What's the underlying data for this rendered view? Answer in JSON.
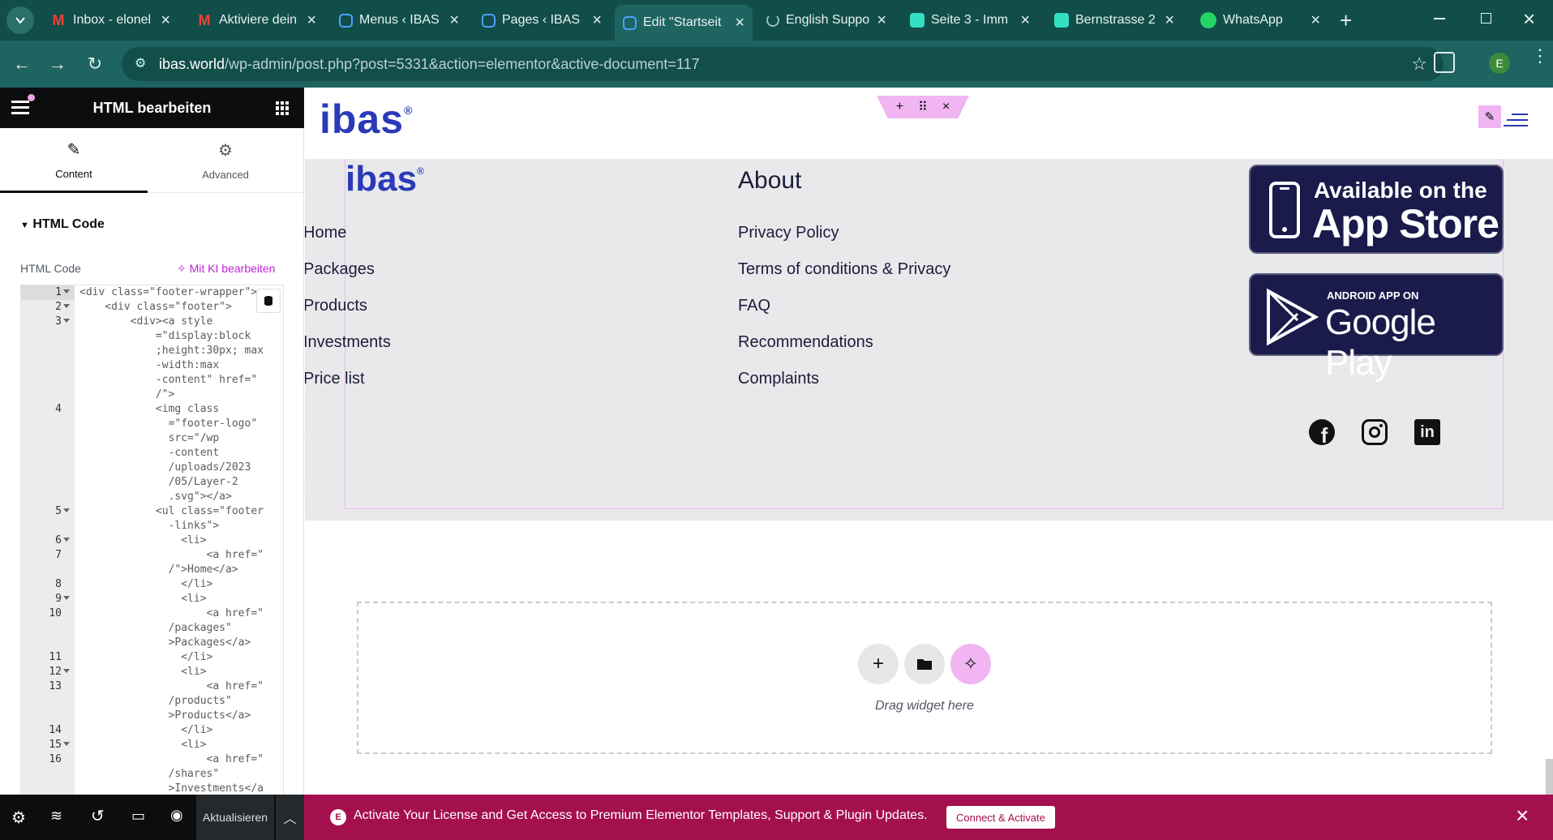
{
  "browser": {
    "tabs": [
      {
        "title": "Inbox - elonel",
        "icon": "gmail-icon",
        "active": false
      },
      {
        "title": "Aktiviere dein",
        "icon": "gmail-icon",
        "active": false
      },
      {
        "title": "Menus ‹ IBAS",
        "icon": "elementor-icon",
        "active": false
      },
      {
        "title": "Pages ‹ IBAS",
        "icon": "elementor-icon",
        "active": false
      },
      {
        "title": "Edit \"Startseit",
        "icon": "elementor-icon",
        "active": true
      },
      {
        "title": "English Suppo",
        "icon": "loading-icon",
        "active": false
      },
      {
        "title": "Seite 3 - Imm",
        "icon": "site-icon",
        "active": false
      },
      {
        "title": "Bernstrasse 2",
        "icon": "site-icon",
        "active": false
      },
      {
        "title": "WhatsApp",
        "icon": "whatsapp-icon",
        "active": false
      }
    ],
    "url_host": "ibas.world",
    "url_path": "/wp-admin/post.php?post=5331&action=elementor&active-document=117",
    "profile_letter": "E"
  },
  "sidebar": {
    "title": "HTML bearbeiten",
    "tabs": [
      {
        "label": "Content"
      },
      {
        "label": "Advanced"
      }
    ],
    "section_title": "HTML Code",
    "field_label": "HTML Code",
    "ai_button": "Mit KI bearbeiten",
    "code_lines": [
      {
        "n": "1",
        "fold": true,
        "text": "<div class=\"footer-wrapper\">"
      },
      {
        "n": "2",
        "fold": true,
        "text": "    <div class=\"footer\">"
      },
      {
        "n": "3",
        "fold": true,
        "text": "        <div><a style"
      },
      {
        "n": "",
        "fold": false,
        "text": "            =\"display:block"
      },
      {
        "n": "",
        "fold": false,
        "text": "            ;height:30px; max"
      },
      {
        "n": "",
        "fold": false,
        "text": "            -width:max"
      },
      {
        "n": "",
        "fold": false,
        "text": "            -content\" href=\""
      },
      {
        "n": "",
        "fold": false,
        "text": "            /\">"
      },
      {
        "n": "4",
        "fold": false,
        "text": "            <img class"
      },
      {
        "n": "",
        "fold": false,
        "text": "              =\"footer-logo\""
      },
      {
        "n": "",
        "fold": false,
        "text": "              src=\"/wp"
      },
      {
        "n": "",
        "fold": false,
        "text": "              -content"
      },
      {
        "n": "",
        "fold": false,
        "text": "              /uploads/2023"
      },
      {
        "n": "",
        "fold": false,
        "text": "              /05/Layer-2"
      },
      {
        "n": "",
        "fold": false,
        "text": "              .svg\"></a>"
      },
      {
        "n": "5",
        "fold": true,
        "text": "            <ul class=\"footer"
      },
      {
        "n": "",
        "fold": false,
        "text": "              -links\">"
      },
      {
        "n": "6",
        "fold": true,
        "text": "                <li>"
      },
      {
        "n": "7",
        "fold": false,
        "text": "                    <a href=\""
      },
      {
        "n": "",
        "fold": false,
        "text": "              /\">Home</a>"
      },
      {
        "n": "8",
        "fold": false,
        "text": "                </li>"
      },
      {
        "n": "9",
        "fold": true,
        "text": "                <li>"
      },
      {
        "n": "10",
        "fold": false,
        "text": "                    <a href=\""
      },
      {
        "n": "",
        "fold": false,
        "text": "              /packages\""
      },
      {
        "n": "",
        "fold": false,
        "text": "              >Packages</a>"
      },
      {
        "n": "11",
        "fold": false,
        "text": "                </li>"
      },
      {
        "n": "12",
        "fold": true,
        "text": "                <li>"
      },
      {
        "n": "13",
        "fold": false,
        "text": "                    <a href=\""
      },
      {
        "n": "",
        "fold": false,
        "text": "              /products\""
      },
      {
        "n": "",
        "fold": false,
        "text": "              >Products</a>"
      },
      {
        "n": "14",
        "fold": false,
        "text": "                </li>"
      },
      {
        "n": "15",
        "fold": true,
        "text": "                <li>"
      },
      {
        "n": "16",
        "fold": false,
        "text": "                    <a href=\""
      },
      {
        "n": "",
        "fold": false,
        "text": "              /shares\""
      },
      {
        "n": "",
        "fold": false,
        "text": "              >Investments</a"
      }
    ],
    "bottom_update": "Aktualisieren"
  },
  "canvas": {
    "logo_text": "ibas",
    "logo_mark": "®",
    "col1_links": [
      "Home",
      "Packages",
      "Products",
      "Investments",
      "Price list"
    ],
    "col2_title": "About",
    "col2_links": [
      "Privacy Policy",
      "Terms of conditions & Privacy",
      "FAQ",
      "Recommendations",
      "Complaints"
    ],
    "appstore_top": "Available on the",
    "appstore_main": "App Store",
    "gplay_top": "ANDROID APP ON",
    "gplay_main": "Google Play",
    "social": [
      "facebook-icon",
      "instagram-icon",
      "linkedin-icon"
    ],
    "drag_text": "Drag widget here"
  },
  "notice": {
    "text": "Activate Your License and Get Access to Premium Elementor Templates, Support & Plugin Updates.",
    "button": "Connect & Activate"
  },
  "colors": {
    "chrome_dark": "#114e4a",
    "chrome": "#1e6460",
    "brand_blue": "#2a3ab8",
    "accent_pink": "#e8a5ee",
    "notice": "#a4104e",
    "badge": "#1a1a4b"
  }
}
